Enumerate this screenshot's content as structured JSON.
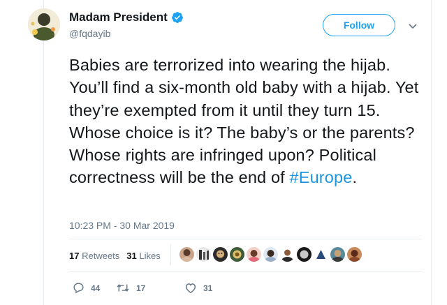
{
  "author": {
    "display_name": "Madam President",
    "handle": "@fqdayib",
    "verified": true
  },
  "follow_label": "Follow",
  "tweet": {
    "text": "Babies are terrorized into wearing the hijab. You’ll find a six-month old baby with a hijab. Yet they’re exempted from it until they turn 15. Whose choice is it? The baby’s or the parents? Whose rights are infringed upon? Political correctness will be the end of ",
    "hashtag": "#Europe",
    "trailing": ".",
    "timestamp": "10:23 PM - 30 Mar 2019"
  },
  "stats": {
    "retweets_count": "17",
    "retweets_label": "Retweets",
    "likes_count": "31",
    "likes_label": "Likes"
  },
  "actions": {
    "replies": "44",
    "retweets": "17",
    "likes": "31"
  },
  "colors": {
    "accent": "#1da1f2",
    "hashtag": "#1b95e0",
    "muted": "#657786"
  }
}
